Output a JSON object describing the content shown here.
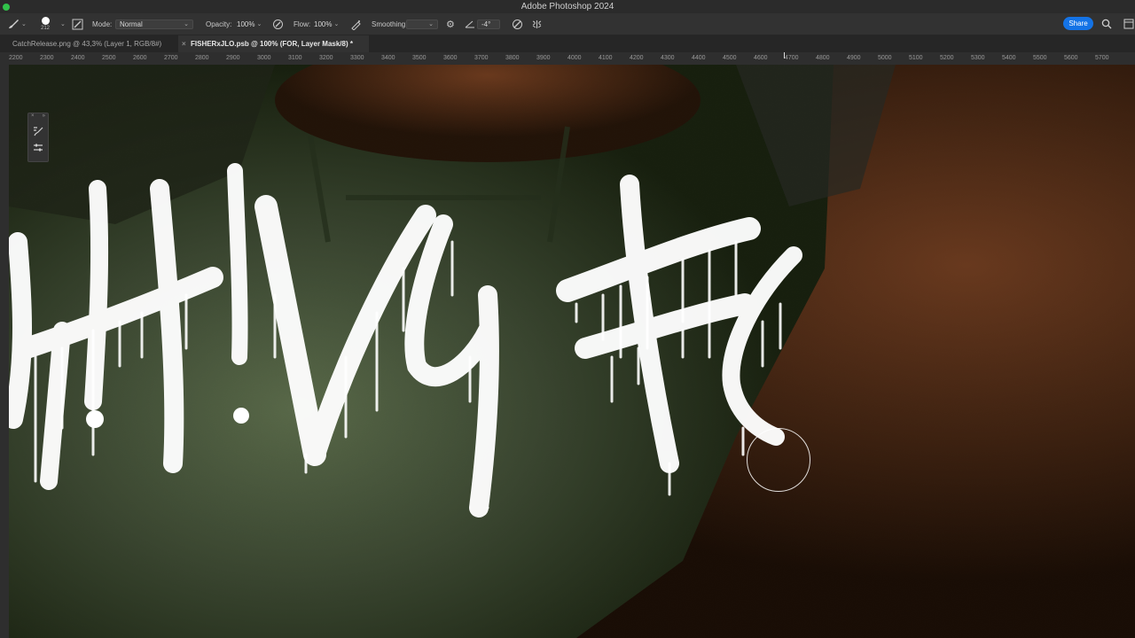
{
  "window": {
    "title": "Adobe Photoshop 2024"
  },
  "options": {
    "brush_size": "212",
    "mode_label": "Mode:",
    "mode_value": "Normal",
    "opacity_label": "Opacity:",
    "opacity_value": "100%",
    "flow_label": "Flow:",
    "flow_value": "100%",
    "smoothing_label": "Smoothing:",
    "angle_value": "-4°",
    "share_label": "Share"
  },
  "tabs": [
    {
      "label": "CatchRelease.png @ 43,3% (Layer 1, RGB/8#)",
      "active": false
    },
    {
      "label": "FISHERxJLO.psb @ 100% (FOR, Layer Mask/8) *",
      "active": true
    }
  ],
  "ruler": {
    "ticks": [
      "2200",
      "2300",
      "2400",
      "2500",
      "2600",
      "2700",
      "2800",
      "2900",
      "3000",
      "3100",
      "3200",
      "3300",
      "3400",
      "3500",
      "3600",
      "3700",
      "3800",
      "3900",
      "4000",
      "4100",
      "4200",
      "4300",
      "4400",
      "4500",
      "4600",
      "4700",
      "4800",
      "4900",
      "5000",
      "5100",
      "5200",
      "5300",
      "5400",
      "5500",
      "5600",
      "5700"
    ]
  },
  "colors": {
    "accent": "#1473e6",
    "close_button": "#31c24a"
  }
}
